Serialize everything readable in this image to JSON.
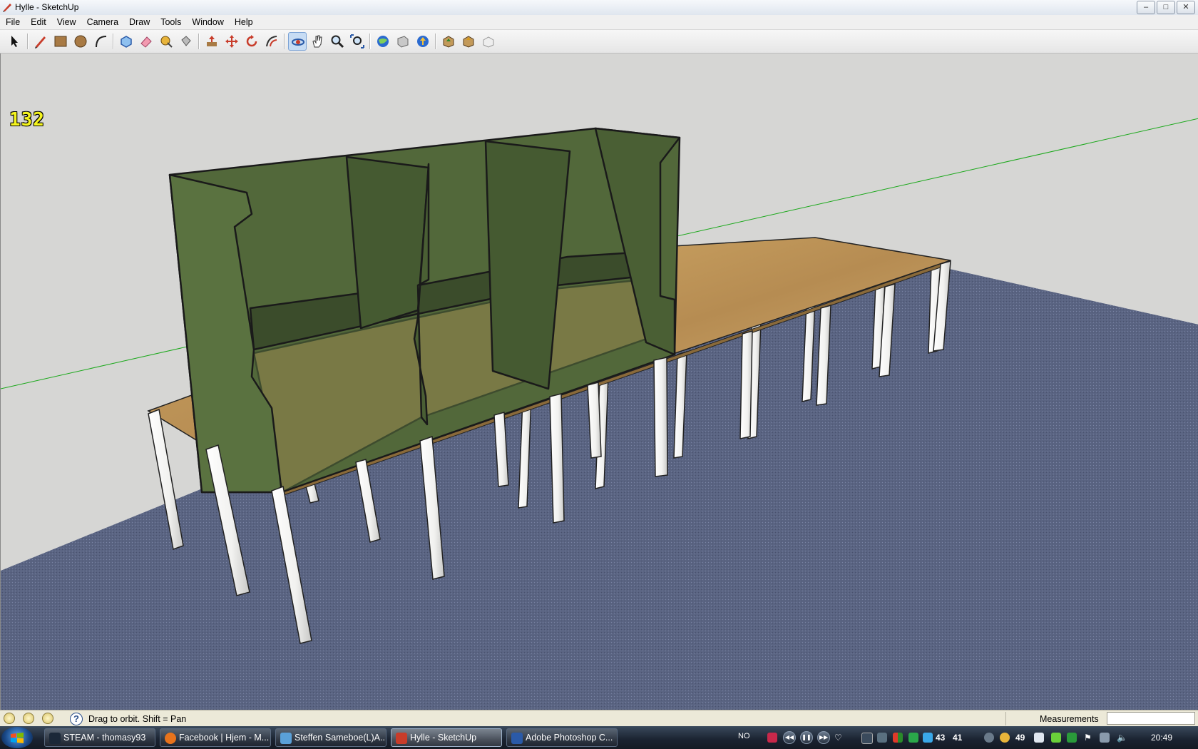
{
  "window": {
    "title": "Hylle - SketchUp"
  },
  "menu": [
    "File",
    "Edit",
    "View",
    "Camera",
    "Draw",
    "Tools",
    "Window",
    "Help"
  ],
  "toolbar": {
    "tools": [
      "select-tool",
      "pencil-tool",
      "rectangle-tool",
      "circle-tool",
      "arc-tool",
      "make-component-tool",
      "eraser-tool",
      "tape-measure-tool",
      "paint-bucket-tool",
      "push-pull-tool",
      "move-tool",
      "rotate-tool",
      "offset-tool",
      "orbit-tool",
      "pan-tool",
      "zoom-tool",
      "zoom-extents-tool",
      "get-models-tool",
      "share-model-tool",
      "share-component-tool",
      "get-photo-texture-tool",
      "import-tool",
      "export-tool"
    ],
    "active": "orbit-tool"
  },
  "viewport": {
    "fps": "132"
  },
  "status": {
    "hint": "Drag to orbit.  Shift = Pan",
    "measurements_label": "Measurements",
    "measurements_value": ""
  },
  "taskbar": {
    "tasks": [
      {
        "label": "STEAM - thomasy93",
        "color": "#1b2838"
      },
      {
        "label": "Facebook | Hjem - M...",
        "color": "#e8731c"
      },
      {
        "label": "Steffen Sameboe(L)A...",
        "color": "#5aa0d8"
      },
      {
        "label": "Hylle - SketchUp",
        "color": "#c83c2a"
      },
      {
        "label": "Adobe Photoshop C...",
        "color": "#2a5aa8"
      }
    ],
    "active_index": 3,
    "tray": {
      "lang": "NO",
      "num1": "43",
      "num2": "41",
      "num3": "49",
      "time": "20:49"
    }
  },
  "colors": {
    "accent": "#7ba3d6",
    "wall": "#d6d6d4",
    "floor": "#5a6482",
    "shelf": "#4e6236",
    "wood": "#c39a5a",
    "legs": "#f2f2f0"
  }
}
